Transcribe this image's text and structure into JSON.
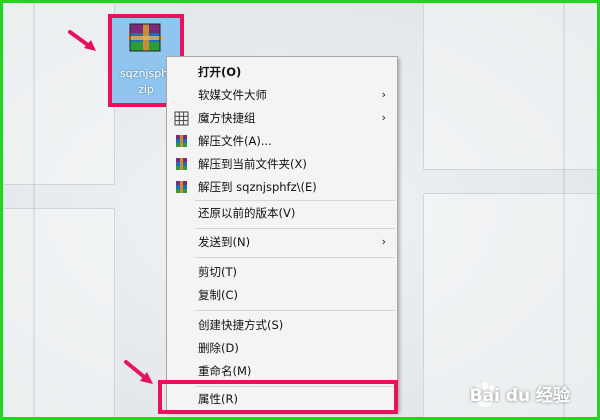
{
  "desktop_icon": {
    "label": "sqznjsphf\nzip",
    "icon": "winrar-archive-icon"
  },
  "context_menu": {
    "items": [
      {
        "label": "打开(O)",
        "icon": ""
      },
      {
        "label": "软媒文件大师",
        "icon": "",
        "submenu": "›"
      },
      {
        "label": "魔方快捷组",
        "icon": "grid-icon",
        "submenu": "›"
      },
      {
        "label": "解压文件(A)...",
        "icon": "winrar-icon"
      },
      {
        "label": "解压到当前文件夹(X)",
        "icon": "winrar-icon"
      },
      {
        "label": "解压到 sqznjsphfz\\(E)",
        "icon": "winrar-icon"
      },
      {
        "label": "还原以前的版本(V)",
        "icon": ""
      },
      {
        "label": "发送到(N)",
        "icon": "",
        "submenu": "›"
      },
      {
        "label": "剪切(T)",
        "icon": ""
      },
      {
        "label": "复制(C)",
        "icon": ""
      },
      {
        "label": "创建快捷方式(S)",
        "icon": ""
      },
      {
        "label": "删除(D)",
        "icon": ""
      },
      {
        "label": "重命名(M)",
        "icon": ""
      },
      {
        "label": "属性(R)",
        "icon": ""
      }
    ]
  },
  "watermark": {
    "text": "Bai du 经验",
    "logo": "baidu-paw-icon"
  },
  "colors": {
    "highlight_box": "#e8115d",
    "frame": "#22d61f",
    "selection": "#8fc5ee"
  }
}
